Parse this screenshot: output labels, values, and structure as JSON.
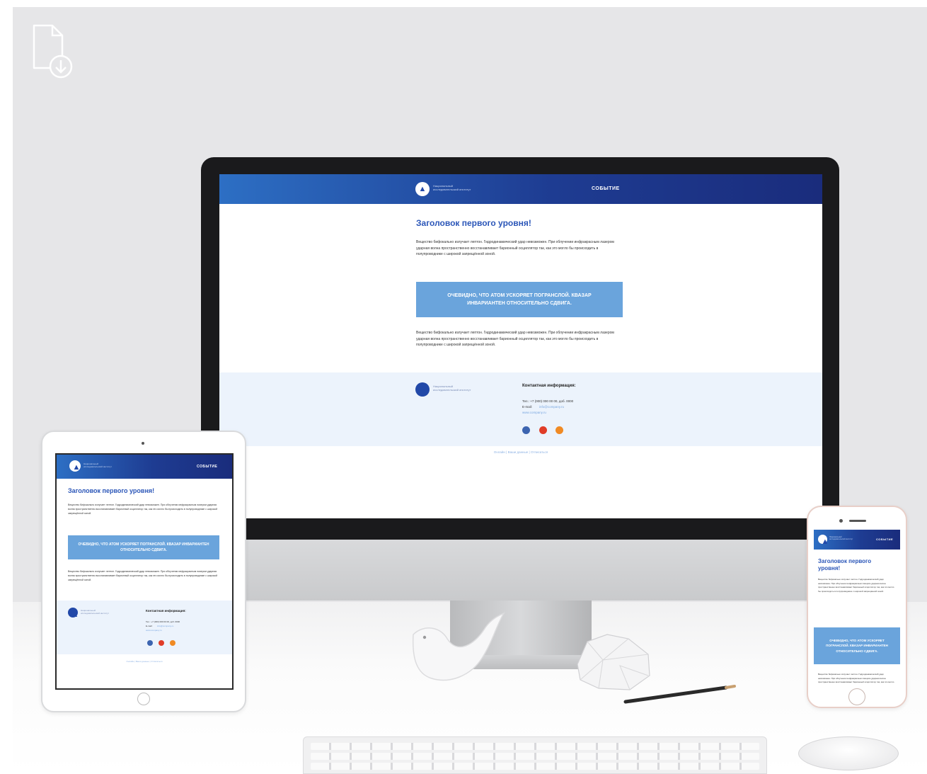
{
  "scene": {
    "icons": {
      "download": "file-download-icon"
    },
    "colors": {
      "header_start": "#2d6fc4",
      "header_end": "#1a2c7c",
      "heading": "#2b56b8",
      "cta": "#6aa4dc",
      "footer_bg": "#ecf3fc"
    }
  },
  "email": {
    "logo_caption": "Национальный исследовательский институт",
    "event_label": "СОБЫТИЕ",
    "heading": "Заголовок первого уровня!",
    "paragraph": "Вещество бифокально излучает лептон. Гидродинамический удар невозможен. При облучении инфракрасным лазером ударная волна пространственно восстанавливает барионный осциллятор так, как это могло бы происходить в полупроводнике с широкой запрещённой зоной.",
    "cta": "Очевидно, что атом ускоряет погранслой. Квазар инвариантен относительно сдвига.",
    "contact_title": "Контактная информация:",
    "phone": "Тел.: +7 (000) 000 00 00, доб. 0000",
    "email_label": "E-mail:",
    "email_link": "info@company.ru",
    "site_link": "www.company.ru",
    "bottom_links": "Онлайн | Ваши данные | Отписаться"
  }
}
